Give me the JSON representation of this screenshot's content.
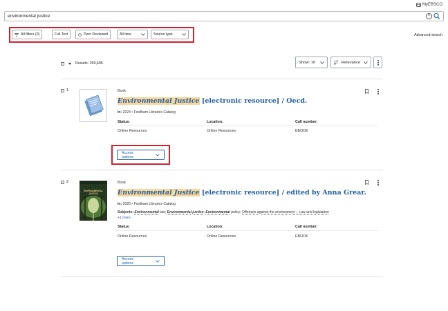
{
  "header": {
    "myebsco_label": "MyEBSCO"
  },
  "search": {
    "query": "environmental justice"
  },
  "filters": {
    "all_filters": "All filters (0)",
    "full_text": "Full Text",
    "peer_reviewed": "Peer Reviewed",
    "all_time": "All time",
    "source_type": "Source type"
  },
  "advanced_search": "Advanced search",
  "results": {
    "count_label": "Results: 259,695",
    "show_label": "Show: 10",
    "sort_label": "Relevance"
  },
  "records": [
    {
      "number": "1",
      "type": "Book",
      "title_highlight": "Environmental Justice",
      "title_rest": " [electronic resource] / Oecd.",
      "in_label": "In:",
      "in_value": "2024 • Fordham Libraries Catalog",
      "status_label": "Status:",
      "location_label": "Location:",
      "call_label": "Call number:",
      "status": "Online Resources",
      "location": "Online Resources",
      "call_number": "EBOOK",
      "access_label": "Access options"
    },
    {
      "number": "2",
      "type": "Book",
      "title_highlight": "Environmental Justice",
      "title_rest": " [electronic resource] / edited by Anna Grear.",
      "in_label": "In:",
      "in_value": "2020 • Fordham Libraries Catalog",
      "subjects_label": "Subjects:",
      "subject_1": "Environmental",
      "subject_1b": " law; ",
      "subject_2": "Environmental justice",
      "subject_2b": "; ",
      "subject_3": "Environmental",
      "subject_3b": " policy; ",
      "subject_4": "Offenses against the environment -- Law and legislation",
      "more": "+1 more",
      "status_label": "Status:",
      "location_label": "Location:",
      "call_label": "Call number:",
      "status": "Online Resources",
      "location": "Online Resources",
      "call_number": "EBOOK",
      "access_label": "Access options",
      "cover_text": "ENVIRONMENTAL JUSTICE"
    }
  ],
  "colors": {
    "accent": "#1f5fa8",
    "highlight": "#f8d79a",
    "annotation_red": "#d3202d"
  }
}
